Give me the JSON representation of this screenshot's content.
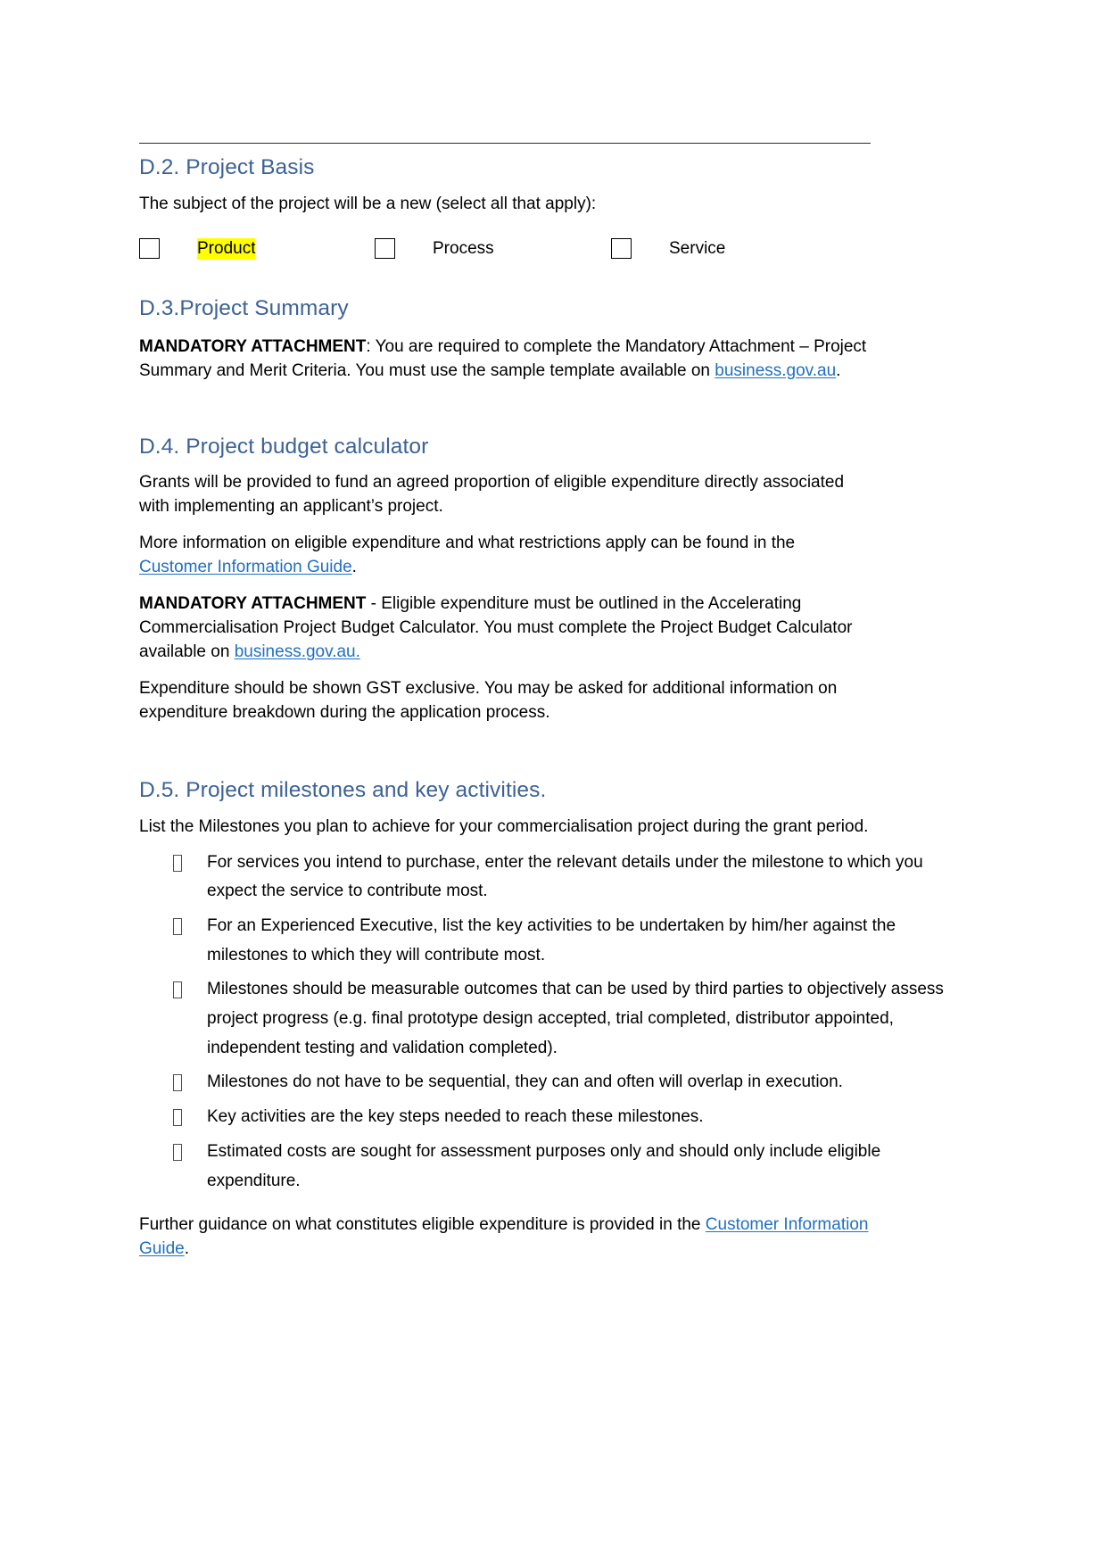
{
  "document": {
    "sections": [
      {
        "id": "d2",
        "heading": "D.2. Project Basis",
        "intro": "The subject of the project will be a new (select all that apply):",
        "options": [
          {
            "label": "Product",
            "highlighted": true,
            "checked": false
          },
          {
            "label": "Process",
            "highlighted": false,
            "checked": false
          },
          {
            "label": "Service",
            "highlighted": false,
            "checked": false
          }
        ]
      },
      {
        "id": "d3",
        "heading": "D.3.Project Summary",
        "paragraph": {
          "bold_lead": "MANDATORY ATTACHMENT",
          "text_before_link": ": You are required to complete the Mandatory Attachment – Project Summary and Merit Criteria. You must use the sample template available on ",
          "link_text": "business.gov.au",
          "text_after_link": "."
        }
      },
      {
        "id": "d4",
        "heading": "D.4. Project budget calculator",
        "paragraph_1": "Grants will be provided to fund an agreed proportion of eligible expenditure directly associated with implementing an applicant’s project.",
        "paragraph_2": {
          "text_before_link": "More information on eligible expenditure and what restrictions apply can be found in the ",
          "link_text": "Customer Information Guide",
          "text_after_link": "."
        },
        "paragraph_3": {
          "bold_lead": "MANDATORY ATTACHMENT",
          "text_before_link": " - Eligible expenditure must be outlined in the Accelerating Commercialisation Project Budget Calculator. You must complete the Project Budget Calculator available on ",
          "link_text": "business.gov.au.",
          "text_after_link": ""
        },
        "paragraph_4": "Expenditure should be shown GST exclusive. You may be asked for additional information on expenditure breakdown during the application process."
      },
      {
        "id": "d5",
        "heading": "D.5. Project milestones and key activities.",
        "intro": "List the Milestones you plan to achieve for your commercialisation project during the grant period.",
        "bullets": [
          "For services you intend to purchase, enter the relevant details under the milestone to which you expect the service to contribute most.",
          "For an Experienced Executive, list the key activities to be undertaken by him/her against the milestones to which they will contribute most.",
          "Milestones should be measurable outcomes that can be used by third parties to objectively assess project progress (e.g. final prototype design accepted, trial completed, distributor appointed, independent testing and validation completed).",
          "Milestones do not have to be sequential, they can and often will overlap in execution.",
          "Key activities are the key steps needed to reach these milestones.",
          "Estimated costs are sought for assessment purposes only and should only include eligible expenditure."
        ],
        "closing": {
          "text_before_link": "Further guidance on what constitutes eligible expenditure is provided in the ",
          "link_text": "Customer Information Guide",
          "text_after_link": "."
        }
      }
    ]
  },
  "colors": {
    "heading": "#3d6296",
    "link": "#1f6fc4",
    "highlight": "#ffff00",
    "body_text": "#000000",
    "rule": "#2b2b2b"
  }
}
